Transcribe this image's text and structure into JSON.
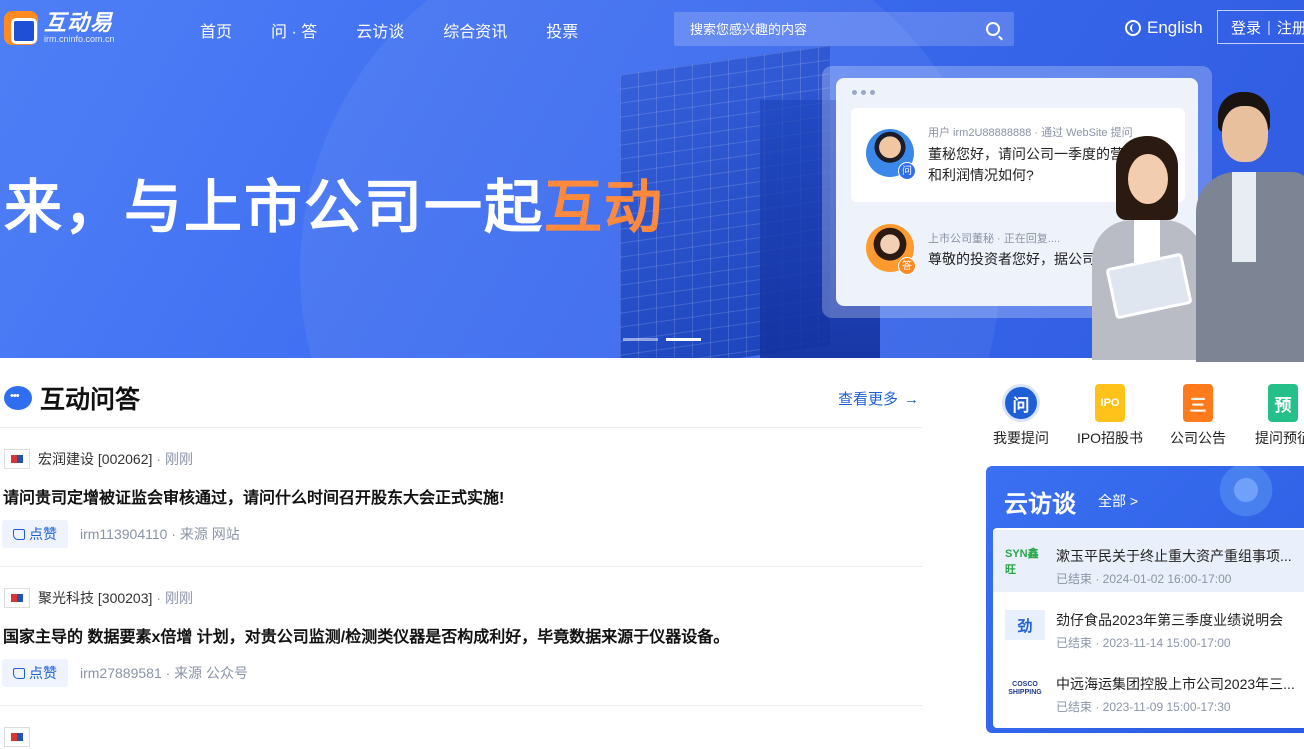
{
  "header": {
    "logo": {
      "title": "互动易",
      "subtitle": "irm.cninfo.com.cn"
    },
    "nav": [
      "首页",
      "问 · 答",
      "云访谈",
      "综合资讯",
      "投票"
    ],
    "search": {
      "placeholder": "搜索您感兴趣的内容"
    },
    "language": "English",
    "login": "登录",
    "register": "注册"
  },
  "hero": {
    "slogan_main": "来，与上市公司一起",
    "slogan_highlight": "互动",
    "chat": {
      "question_meta": "用户 irm2U88888888 · 通过 WebSite 提问",
      "question_text": "董秘您好，请问公司一季度的营收和利润情况如何?",
      "question_badge": "问",
      "answer_meta": "上市公司董秘 · 正在回复....",
      "answer_text": "尊敬的投资者您好，据公司",
      "answer_badge": "答"
    },
    "carousel": {
      "count": 2,
      "active_index": 1
    }
  },
  "qa": {
    "title": "互动问答",
    "more": "查看更多",
    "items": [
      {
        "company": "宏润建设 [002062]",
        "time": "刚刚",
        "question": "请问贵司定增被证监会审核通过，请问什么时间召开股东大会正式实施!",
        "like_label": "点赞",
        "user": "irm113904110 · 来源 网站"
      },
      {
        "company": "聚光科技 [300203]",
        "time": "刚刚",
        "question": "国家主导的 数据要素x倍增 计划，对贵公司监测/检测类仪器是否构成利好，毕竟数据来源于仪器设备。",
        "like_label": "点赞",
        "user": "irm27889581 · 来源 公众号"
      }
    ]
  },
  "quick_links": [
    {
      "label": "我要提问",
      "icon": "question-icon",
      "glyph": "问"
    },
    {
      "label": "IPO招股书",
      "icon": "ipo-icon",
      "glyph": "IPO"
    },
    {
      "label": "公司公告",
      "icon": "announcement-icon",
      "glyph": "三"
    },
    {
      "label": "提问预征",
      "icon": "pre-collect-icon",
      "glyph": "预"
    }
  ],
  "yft": {
    "title": "云访谈",
    "all": "全部 >",
    "items": [
      {
        "logo": "SYN鑫旺",
        "name": "漱玉平民关于终止重大资产重组事项...",
        "time": "已结束 · 2024-01-02 16:00-17:00"
      },
      {
        "logo": "劲",
        "name": "劲仔食品2023年第三季度业绩说明会",
        "time": "已结束 · 2023-11-14 15:00-17:00"
      },
      {
        "logo": "COSCO SHIPPING",
        "name": "中远海运集团控股上市公司2023年三...",
        "time": "已结束 · 2023-11-09 15:00-17:30"
      }
    ]
  },
  "colors": {
    "brand_blue": "#3c6cf0",
    "accent_orange": "#ff8a3d",
    "link_blue": "#1f5fd6"
  }
}
